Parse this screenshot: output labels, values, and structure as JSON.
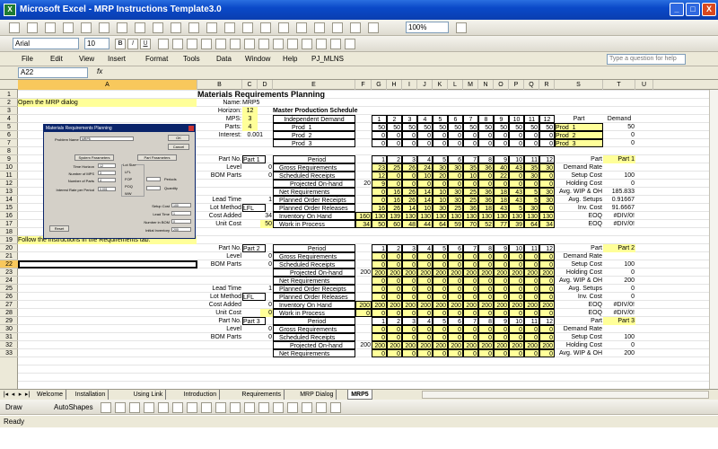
{
  "window": {
    "title": "Microsoft Excel - MRP Instructions Template3.0",
    "app_icon": "X",
    "minimize": "_",
    "maximize": "□",
    "close": "X"
  },
  "toolbar1": {
    "zoom": "100%"
  },
  "toolbar2": {
    "font": "Arial",
    "size": "10",
    "bold": "B",
    "italic": "I",
    "underline": "U"
  },
  "menu": {
    "items": [
      "File",
      "Edit",
      "View",
      "Insert",
      "Format",
      "Tools",
      "Data",
      "Window",
      "Help",
      "PJ_MLNS"
    ],
    "help_placeholder": "Type a question for help"
  },
  "formula": {
    "cell": "A22",
    "fx": "fx"
  },
  "columns": [
    "A",
    "B",
    "C",
    "D",
    "E",
    "F",
    "G",
    "H",
    "I",
    "J",
    "K",
    "L",
    "M",
    "N",
    "O",
    "P",
    "Q",
    "R",
    "S",
    "T",
    "U"
  ],
  "rows": [
    "1",
    "2",
    "3",
    "4",
    "5",
    "6",
    "7",
    "8",
    "9",
    "10",
    "11",
    "12",
    "13",
    "14",
    "15",
    "16",
    "17",
    "18",
    "19",
    "20",
    "21",
    "22",
    "23",
    "24",
    "25",
    "26",
    "27",
    "28",
    "29",
    "30",
    "31",
    "32",
    "33"
  ],
  "sheet": {
    "title": "Materials Requirements Planning",
    "note_open": "Open the MRP dialog",
    "note_follow": "Follow the instructions in the Requirements tab.",
    "header": {
      "name_label": "Name:",
      "name_value": "MRP5",
      "horizon_label": "Horizon:",
      "horizon_value": "12",
      "mps_label": "MPS:",
      "mps_value": "3",
      "parts_label": "Parts:",
      "parts_value": "4",
      "interest_label": "Interest:",
      "interest_value": "0.001",
      "mps_title": "Master Production Schedule"
    },
    "mps": {
      "col_header": "Independent Demand",
      "periods": [
        "1",
        "2",
        "3",
        "4",
        "5",
        "6",
        "7",
        "8",
        "9",
        "10",
        "11",
        "12"
      ],
      "rows": [
        {
          "name": "Prod_1",
          "vals": [
            "50",
            "50",
            "50",
            "50",
            "50",
            "50",
            "50",
            "50",
            "50",
            "50",
            "50",
            "50"
          ]
        },
        {
          "name": "Prod_2",
          "vals": [
            "0",
            "0",
            "0",
            "0",
            "0",
            "0",
            "0",
            "0",
            "0",
            "0",
            "0",
            "0"
          ]
        },
        {
          "name": "Prod_3",
          "vals": [
            "0",
            "0",
            "0",
            "0",
            "0",
            "0",
            "0",
            "0",
            "0",
            "0",
            "0",
            "0"
          ]
        }
      ],
      "demand_header_part": "Part",
      "demand_header_demand": "Demand",
      "demand": [
        {
          "part": "Prod_1",
          "value": "50"
        },
        {
          "part": "Prod_2",
          "value": "0"
        },
        {
          "part": "Prod_3",
          "value": "0"
        }
      ]
    },
    "left_labels": [
      "Part No.",
      "Level",
      "BOM Parts",
      "",
      "",
      "Lead Time",
      "Lot Method",
      "Cost Added",
      "Unit Cost"
    ],
    "period_rows": [
      "Period",
      "Gross Requirements",
      "Scheduled Receipts",
      "Projected On-hand",
      "Net Requirements",
      "Planned Order Receipts",
      "Planned Order Releases",
      "Inventory On Hand",
      "Work in Process"
    ],
    "right_labels": [
      "Part",
      "Demand Rate",
      "Setup Cost",
      "Holding Cost",
      "Avg. WIP & OH",
      "Avg. Setups",
      "Inv. Cost",
      "EOQ",
      "EOQ"
    ],
    "blocks": [
      {
        "part": "Part 1",
        "level": "0",
        "bom": "0",
        "onhand_init": "20",
        "lead": "1",
        "lot": "LFL",
        "cost_added": "34",
        "unit_cost": "50",
        "proj_onhand_label": "Projected On-hand",
        "data": [
          [
            "1",
            "2",
            "3",
            "4",
            "5",
            "6",
            "7",
            "8",
            "9",
            "10",
            "11",
            "12"
          ],
          [
            "23",
            "25",
            "26",
            "24",
            "30",
            "30",
            "35",
            "36",
            "40",
            "43",
            "35",
            "30"
          ],
          [
            "12",
            "0",
            "0",
            "10",
            "20",
            "0",
            "10",
            "0",
            "22",
            "0",
            "30",
            "0"
          ],
          [
            "9",
            "0",
            "0",
            "0",
            "0",
            "0",
            "0",
            "0",
            "0",
            "0",
            "0",
            "0"
          ],
          [
            "0",
            "16",
            "26",
            "14",
            "10",
            "30",
            "25",
            "36",
            "18",
            "43",
            "5",
            "30"
          ],
          [
            "0",
            "16",
            "26",
            "14",
            "10",
            "30",
            "25",
            "36",
            "18",
            "43",
            "5",
            "30"
          ],
          [
            "16",
            "26",
            "14",
            "10",
            "30",
            "25",
            "36",
            "18",
            "43",
            "5",
            "30",
            "0"
          ],
          [
            "130",
            "139",
            "130",
            "130",
            "130",
            "130",
            "130",
            "130",
            "130",
            "130",
            "130",
            "130"
          ],
          [
            "50",
            "60",
            "48",
            "44",
            "64",
            "59",
            "70",
            "52",
            "77",
            "39",
            "64",
            "34"
          ]
        ],
        "first_inv": "160",
        "first_wip": "34",
        "right": [
          "Part 1",
          "",
          "100",
          "0",
          "185.833",
          "0.91667",
          "91.6667",
          "#DIV/0!",
          "#DIV/0!"
        ]
      },
      {
        "part": "Part 2",
        "level": "0",
        "bom": "0",
        "onhand_init": "200",
        "lead": "1",
        "lot": "LFL",
        "cost_added": "0",
        "unit_cost": "0",
        "proj_onhand_label": "Projected On-hand",
        "data": [
          [
            "1",
            "2",
            "3",
            "4",
            "5",
            "6",
            "7",
            "8",
            "9",
            "10",
            "11",
            "12"
          ],
          [
            "0",
            "0",
            "0",
            "0",
            "0",
            "0",
            "0",
            "0",
            "0",
            "0",
            "0",
            "0"
          ],
          [
            "0",
            "0",
            "0",
            "0",
            "0",
            "0",
            "0",
            "0",
            "0",
            "0",
            "0",
            "0"
          ],
          [
            "200",
            "200",
            "200",
            "200",
            "200",
            "200",
            "200",
            "200",
            "200",
            "200",
            "200",
            "200"
          ],
          [
            "0",
            "0",
            "0",
            "0",
            "0",
            "0",
            "0",
            "0",
            "0",
            "0",
            "0",
            "0"
          ],
          [
            "0",
            "0",
            "0",
            "0",
            "0",
            "0",
            "0",
            "0",
            "0",
            "0",
            "0",
            "0"
          ],
          [
            "0",
            "0",
            "0",
            "0",
            "0",
            "0",
            "0",
            "0",
            "0",
            "0",
            "0",
            "0"
          ],
          [
            "200",
            "200",
            "200",
            "200",
            "200",
            "200",
            "200",
            "200",
            "200",
            "200",
            "200",
            "200"
          ],
          [
            "0",
            "0",
            "0",
            "0",
            "0",
            "0",
            "0",
            "0",
            "0",
            "0",
            "0",
            "0"
          ]
        ],
        "first_inv": "200",
        "first_wip": "0",
        "right": [
          "Part 2",
          "",
          "100",
          "0",
          "200",
          "0",
          "0",
          "#DIV/0!",
          "#DIV/0!"
        ]
      },
      {
        "part": "Part 3",
        "level": "0",
        "bom": "0",
        "onhand_init": "200",
        "lead": "",
        "lot": "",
        "cost_added": "",
        "unit_cost": "",
        "proj_onhand_label": "Projected On-hand",
        "data": [
          [
            "1",
            "2",
            "3",
            "4",
            "5",
            "6",
            "7",
            "8",
            "9",
            "10",
            "11",
            "12"
          ],
          [
            "0",
            "0",
            "0",
            "0",
            "0",
            "0",
            "0",
            "0",
            "0",
            "0",
            "0",
            "0"
          ],
          [
            "0",
            "0",
            "0",
            "0",
            "0",
            "0",
            "0",
            "0",
            "0",
            "0",
            "0",
            "0"
          ],
          [
            "200",
            "200",
            "200",
            "200",
            "200",
            "200",
            "200",
            "200",
            "200",
            "200",
            "200",
            "200"
          ],
          [
            "0",
            "0",
            "0",
            "0",
            "0",
            "0",
            "0",
            "0",
            "0",
            "0",
            "0",
            "0"
          ]
        ],
        "right": [
          "Part 3",
          "",
          "100",
          "0",
          "200"
        ]
      }
    ]
  },
  "dialog": {
    "title": "Materials Requirements Planning",
    "problem_name_label": "Problem Name",
    "problem_name": "MRP5",
    "ok": "OK",
    "cancel": "Cancel",
    "system_params": "System Parameters",
    "part_params": "Part Parameters",
    "time_horizon_label": "Time Horizon",
    "time_horizon": "12",
    "num_mps_label": "Number of MPS",
    "num_mps": "3",
    "num_parts_label": "Number of Parts",
    "num_parts": "4",
    "interest_label": "Interest Rate per Period",
    "interest": "0.001",
    "lot_size_label": "Lot Size",
    "lot_options": [
      "LFL",
      "FOP",
      "POQ",
      "WW"
    ],
    "periods_label": "Periods",
    "quantity_label": "Quantity",
    "setup_cost_label": "Setup Cost",
    "setup_cost": "100",
    "lead_time_label": "Lead Time",
    "lead_time": "1",
    "num_bom_label": "Number in BOM",
    "num_bom": "0",
    "init_inv_label": "Initial Inventory",
    "init_inv": "200",
    "reset": "Reset"
  },
  "tabs": [
    "Welcome",
    "Installation",
    "Using Link",
    "Introduction",
    "Requirements",
    "MRP Dialog",
    "MRP5"
  ],
  "drawbar": {
    "draw": "Draw",
    "autoshapes": "AutoShapes"
  },
  "status": "Ready"
}
